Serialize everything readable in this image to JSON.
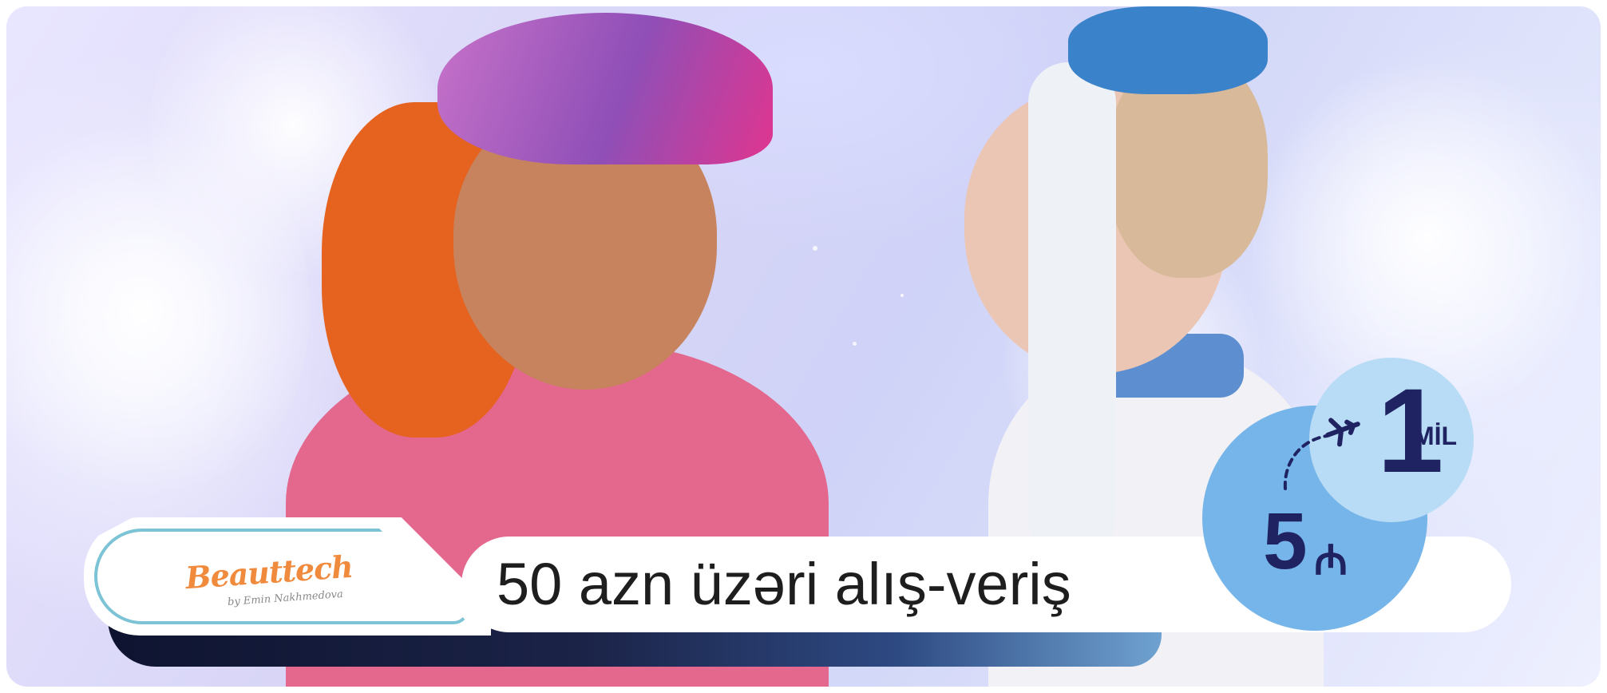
{
  "promo": {
    "headline": "50 azn üzəri alış-veriş",
    "brand": {
      "name": "Beauttech",
      "tagline": "by Emin Nakhmedova"
    },
    "offer": {
      "spend_value": "5",
      "spend_currency": "₼",
      "reward_value": "1",
      "reward_unit": "MİL"
    },
    "icons": {
      "plane": "plane-icon"
    },
    "colors": {
      "brand_orange": "#f08a3c",
      "navy_text": "#1f2361",
      "circle_blue": "#76b5ea",
      "circle_light": "#b9dcf6",
      "accent_teal": "#7cc3d6"
    }
  }
}
